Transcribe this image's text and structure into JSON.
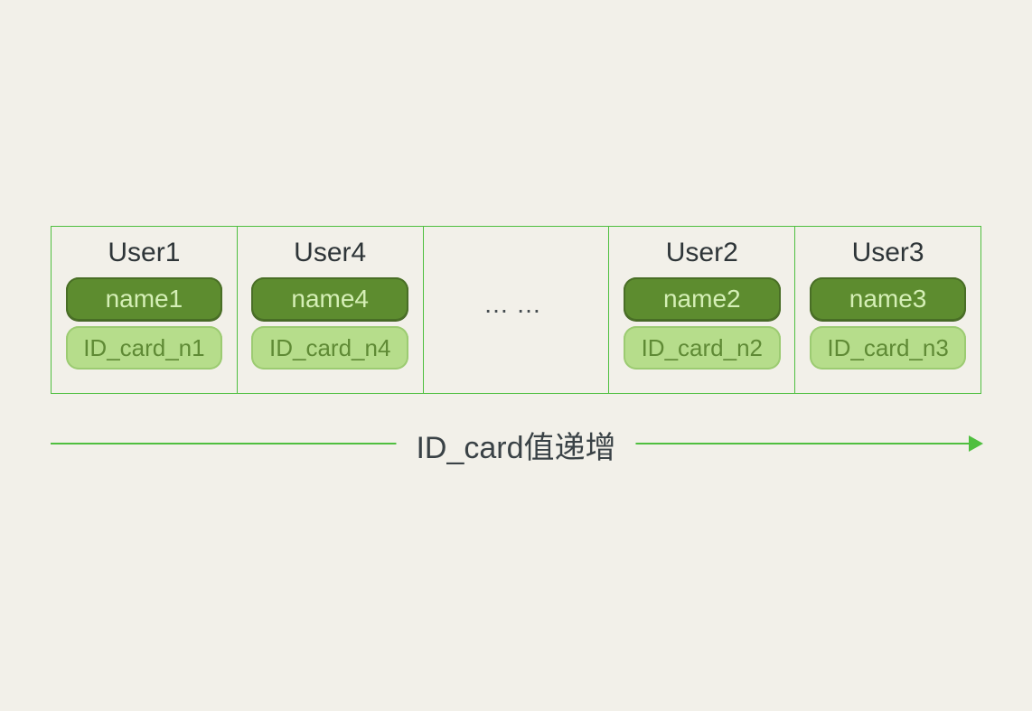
{
  "cells": [
    {
      "title": "User1",
      "name": "name1",
      "id": "ID_card_n1"
    },
    {
      "title": "User4",
      "name": "name4",
      "id": "ID_card_n4"
    },
    {
      "ellipsis": "……"
    },
    {
      "title": "User2",
      "name": "name2",
      "id": "ID_card_n2"
    },
    {
      "title": "User3",
      "name": "name3",
      "id": "ID_card_n3"
    }
  ],
  "arrow_label": "ID_card值递增"
}
